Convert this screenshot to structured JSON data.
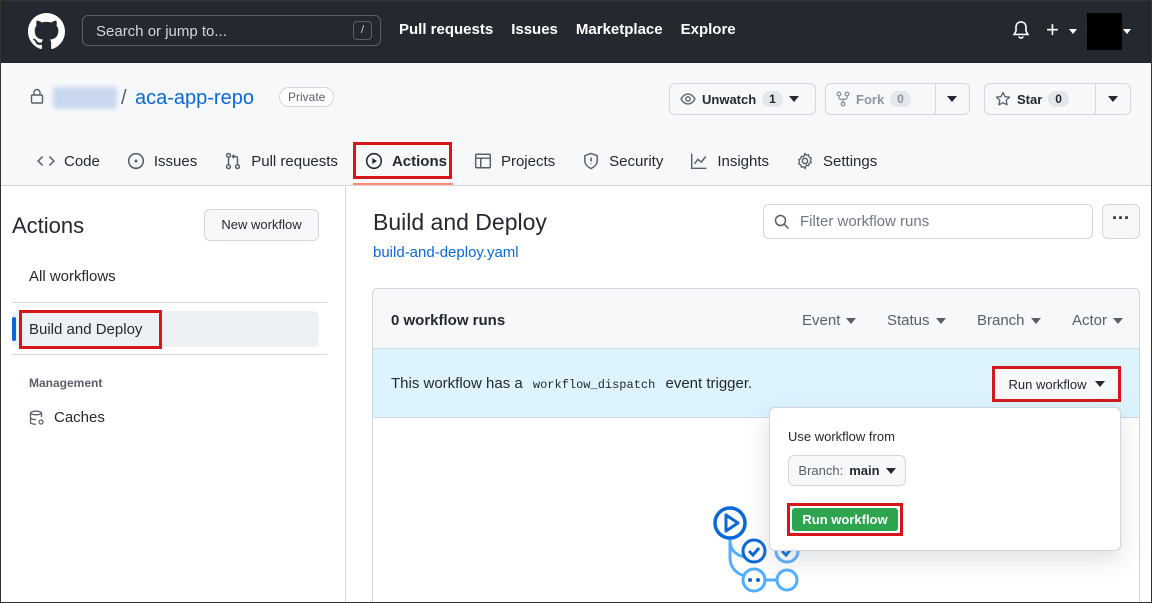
{
  "topbar": {
    "search_placeholder": "Search or jump to...",
    "slash_key": "/",
    "nav": [
      "Pull requests",
      "Issues",
      "Marketplace",
      "Explore"
    ],
    "plus": "+"
  },
  "repo": {
    "separator": "/",
    "name": "aca-app-repo",
    "visibility": "Private",
    "unwatch_label": "Unwatch",
    "unwatch_count": "1",
    "fork_label": "Fork",
    "fork_count": "0",
    "star_label": "Star",
    "star_count": "0"
  },
  "tabs": [
    {
      "label": "Code",
      "icon": "code-icon"
    },
    {
      "label": "Issues",
      "icon": "issue-icon"
    },
    {
      "label": "Pull requests",
      "icon": "pull-request-icon"
    },
    {
      "label": "Actions",
      "icon": "play-icon"
    },
    {
      "label": "Projects",
      "icon": "table-icon"
    },
    {
      "label": "Security",
      "icon": "shield-icon"
    },
    {
      "label": "Insights",
      "icon": "graph-icon"
    },
    {
      "label": "Settings",
      "icon": "gear-icon"
    }
  ],
  "sidebar": {
    "title": "Actions",
    "new_workflow": "New workflow",
    "all_workflows": "All workflows",
    "selected": "Build and Deploy",
    "management_heading": "Management",
    "caches": "Caches"
  },
  "main": {
    "title": "Build and Deploy",
    "file_link": "build-and-deploy.yaml",
    "filter_placeholder": "Filter workflow runs",
    "kebab": "···",
    "runs_count": "0 workflow runs",
    "filters": [
      "Event",
      "Status",
      "Branch",
      "Actor"
    ],
    "dispatch_pre": "This workflow has a",
    "dispatch_code": "workflow_dispatch",
    "dispatch_post": "event trigger.",
    "run_workflow_button": "Run workflow"
  },
  "popup": {
    "label": "Use workflow from",
    "branch_prefix": "Branch:",
    "branch_value": "main",
    "run_button": "Run workflow"
  },
  "colors": {
    "header_bg": "#24292f",
    "highlight_red": "#d5161a",
    "link_blue": "#0969da",
    "run_green": "#2da44e",
    "dispatch_bg": "#ddf4ff"
  }
}
